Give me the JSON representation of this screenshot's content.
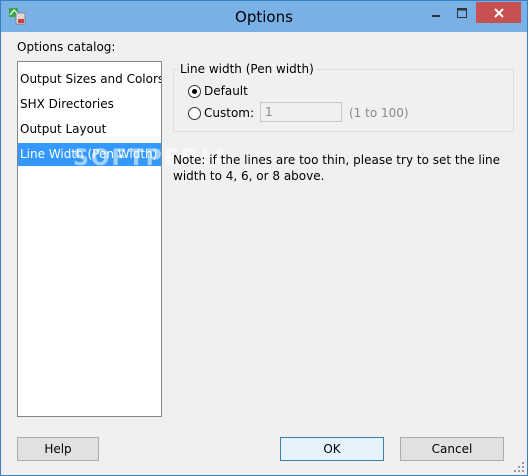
{
  "window": {
    "title": "Options"
  },
  "catalog": {
    "label": "Options catalog:",
    "items": [
      {
        "label": "Output Sizes and Colors"
      },
      {
        "label": "SHX Directories"
      },
      {
        "label": "Output Layout"
      },
      {
        "label": "Line Width (Pen Width)"
      }
    ],
    "selected_index": 3
  },
  "line_width": {
    "group_title": "Line width (Pen width)",
    "default_label": "Default",
    "custom_label": "Custom:",
    "custom_value": "1",
    "range_hint": "(1 to 100)",
    "selected": "default"
  },
  "note": "Note: if the lines are too thin, please try to set the line width to 4, 6, or 8 above.",
  "watermark": "SOFTPEDIA",
  "buttons": {
    "help": "Help",
    "ok": "OK",
    "cancel": "Cancel"
  },
  "colors": {
    "titlebar": "#79b0e6",
    "selection": "#3399ff",
    "close": "#c75050"
  }
}
